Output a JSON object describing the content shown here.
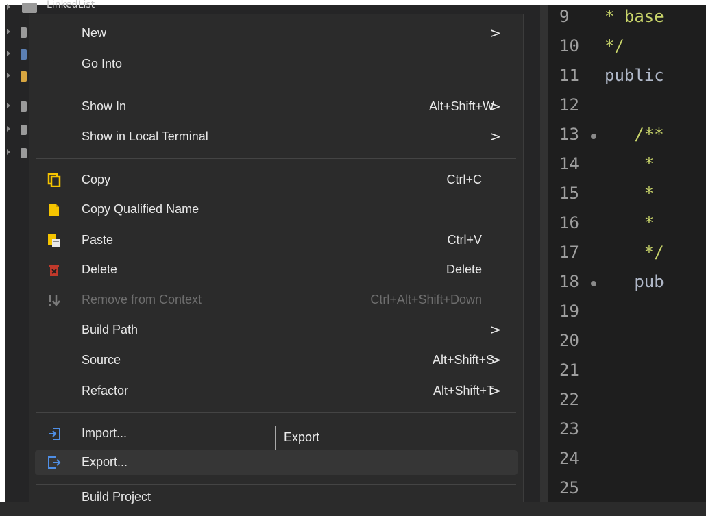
{
  "explorer": {
    "top_item": "LinkedList"
  },
  "editor": {
    "lines": [
      {
        "num": "9",
        "text": "* base",
        "kind": "comment",
        "fold": false
      },
      {
        "num": "10",
        "text": "*/",
        "kind": "comment",
        "fold": false
      },
      {
        "num": "11",
        "text": "public",
        "kind": "kw",
        "fold": false
      },
      {
        "num": "12",
        "text": "",
        "kind": "kw",
        "fold": false
      },
      {
        "num": "13",
        "text": "   /**",
        "kind": "comment",
        "fold": true
      },
      {
        "num": "14",
        "text": "    *",
        "kind": "comment",
        "fold": false
      },
      {
        "num": "15",
        "text": "    *",
        "kind": "comment",
        "fold": false
      },
      {
        "num": "16",
        "text": "    *",
        "kind": "comment",
        "fold": false
      },
      {
        "num": "17",
        "text": "    */",
        "kind": "comment",
        "fold": false
      },
      {
        "num": "18",
        "text": "   pub",
        "kind": "kw",
        "fold": true
      },
      {
        "num": "19",
        "text": "",
        "kind": "kw",
        "fold": false
      },
      {
        "num": "20",
        "text": "",
        "kind": "kw",
        "fold": false
      },
      {
        "num": "21",
        "text": "",
        "kind": "kw",
        "fold": false
      },
      {
        "num": "22",
        "text": "",
        "kind": "kw",
        "fold": false
      },
      {
        "num": "23",
        "text": "",
        "kind": "kw",
        "fold": false
      },
      {
        "num": "24",
        "text": "",
        "kind": "kw",
        "fold": false
      },
      {
        "num": "25",
        "text": "",
        "kind": "kw",
        "fold": false
      }
    ]
  },
  "menu": {
    "new": "New",
    "go_into": "Go Into",
    "show_in": "Show In",
    "show_in_sc": "Alt+Shift+W",
    "show_local_terminal": "Show in Local Terminal",
    "copy": "Copy",
    "copy_sc": "Ctrl+C",
    "copy_qualified": "Copy Qualified Name",
    "paste": "Paste",
    "paste_sc": "Ctrl+V",
    "delete": "Delete",
    "delete_sc": "Delete",
    "remove_context": "Remove from Context",
    "remove_context_sc": "Ctrl+Alt+Shift+Down",
    "build_path": "Build Path",
    "source": "Source",
    "source_sc": "Alt+Shift+S",
    "refactor": "Refactor",
    "refactor_sc": "Alt+Shift+T",
    "import": "Import...",
    "export": "Export...",
    "build_project": "Build Project",
    "submenu_arrow": ">"
  },
  "tooltip": {
    "text": "Export"
  },
  "colors": {
    "menu_bg": "#2b2b2b",
    "hover_bg": "#363636",
    "icon_yellow": "#f5c400",
    "icon_blue": "#4f8fe6",
    "delete_red": "#c0392b",
    "comment": "#c8d46a"
  }
}
